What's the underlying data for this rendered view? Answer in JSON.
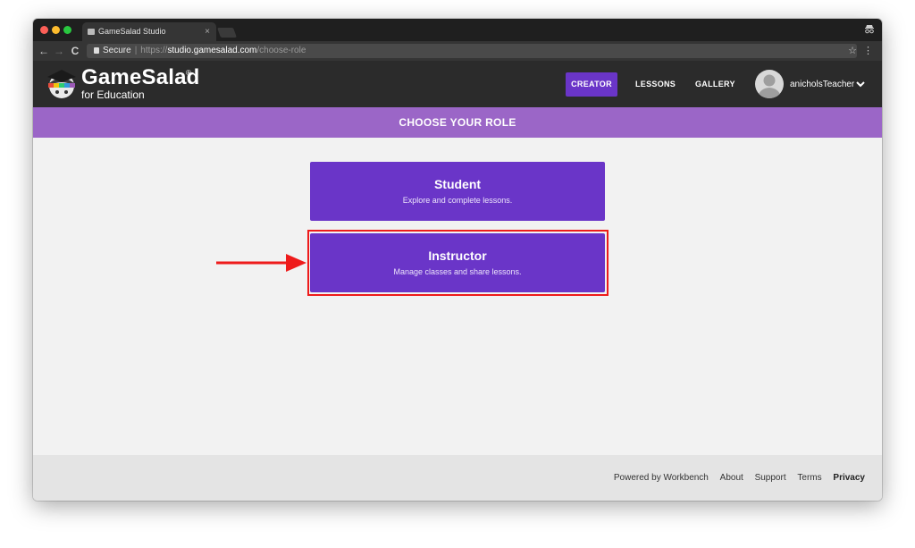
{
  "browser": {
    "tab_title": "GameSalad Studio",
    "tab_close": "×",
    "secure_label": "Secure",
    "url_scheme": "https://",
    "url_host": "studio.gamesalad.com",
    "url_path": "/choose-role",
    "back_glyph": "←",
    "forward_glyph": "→",
    "reload_glyph": "C",
    "star_glyph": "☆",
    "menu_glyph": "⋮"
  },
  "header": {
    "brand_name": "GameSalad",
    "brand_reg": "®",
    "brand_sub": "for Education",
    "nav": [
      {
        "label": "CREATOR",
        "active": true
      },
      {
        "label": "LESSONS",
        "active": false
      },
      {
        "label": "GALLERY",
        "active": false
      }
    ],
    "username": "anicholsTeacher"
  },
  "banner": {
    "title": "CHOOSE YOUR ROLE"
  },
  "roles": [
    {
      "title": "Student",
      "description": "Explore and complete lessons."
    },
    {
      "title": "Instructor",
      "description": "Manage classes and share lessons.",
      "highlighted": true
    }
  ],
  "footer": {
    "powered_by": "Powered by Workbench",
    "links": [
      "About",
      "Support",
      "Terms",
      "Privacy"
    ]
  },
  "colors": {
    "accent_purple": "#6a35c8",
    "banner_purple": "#9b66c7",
    "header_dark": "#2b2b2b",
    "highlight_red": "#ee1b1b"
  }
}
